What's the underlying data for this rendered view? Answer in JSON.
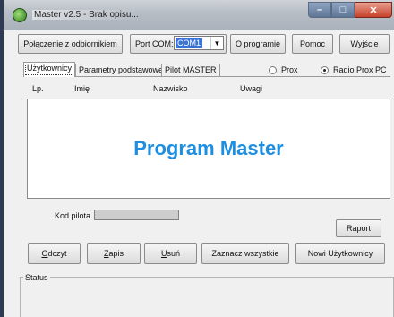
{
  "window": {
    "title": "Master v2.5 - Brak opisu..."
  },
  "toolbar": {
    "connect_label": "Połączenie z odbiornikiem",
    "port_label": "Port COM:",
    "port_value": "COM1",
    "about_label": "O programie",
    "help_label": "Pomoc",
    "exit_label": "Wyjście"
  },
  "tabs": [
    {
      "label": "Użytkownicy",
      "active": true
    },
    {
      "label": "Parametry podstawowe",
      "active": false
    },
    {
      "label": "Pilot MASTER",
      "active": false
    }
  ],
  "mode": {
    "prox_label": "Prox",
    "radio_prox_label": "Radio Prox PC",
    "selected": "Radio Prox PC"
  },
  "table": {
    "columns": [
      "Lp.",
      "Imię",
      "Nazwisko",
      "Uwagi"
    ],
    "watermark": "Program Master"
  },
  "form": {
    "kod_pilota_label": "Kod pilota",
    "kod_pilota_value": ""
  },
  "actions": {
    "raport_label": "Raport",
    "odczyt_label": "Odczyt",
    "zapis_label": "Zapis",
    "usun_label": "Usuń",
    "zaznacz_label": "Zaznacz wszystkie",
    "nowi_label": "Nowi Użytkownicy"
  },
  "status": {
    "label": "Status"
  },
  "colors": {
    "accent": "#1e8ee0",
    "selection": "#3a74d8"
  }
}
